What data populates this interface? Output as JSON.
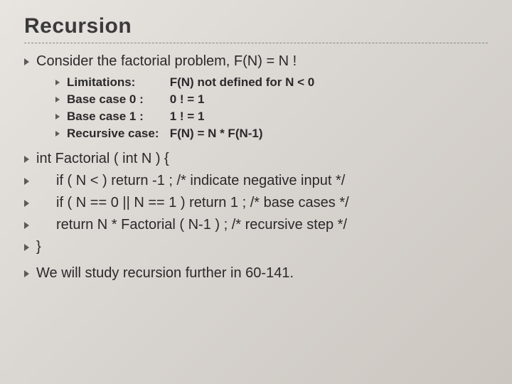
{
  "title": "Recursion",
  "intro": "Consider the factorial problem, F(N) = N !",
  "sub": [
    {
      "label": "Limitations:",
      "value": "F(N) not defined for N < 0"
    },
    {
      "label": "Base case 0 :",
      "value": "0 !  =  1"
    },
    {
      "label": "Base case 1 :",
      "value": "1 !  =  1"
    },
    {
      "label": "Recursive case:",
      "value": "F(N)  =  N * F(N-1)"
    }
  ],
  "code": [
    "int Factorial ( int N ) {",
    "if ( N < ) return  -1 ;   /* indicate negative input */",
    "if ( N == 0 || N == 1 ) return  1 ;   /* base cases */",
    "return   N * Factorial ( N-1 ) ;    /* recursive step */",
    "}"
  ],
  "closing": "We will study recursion further in 60-141."
}
